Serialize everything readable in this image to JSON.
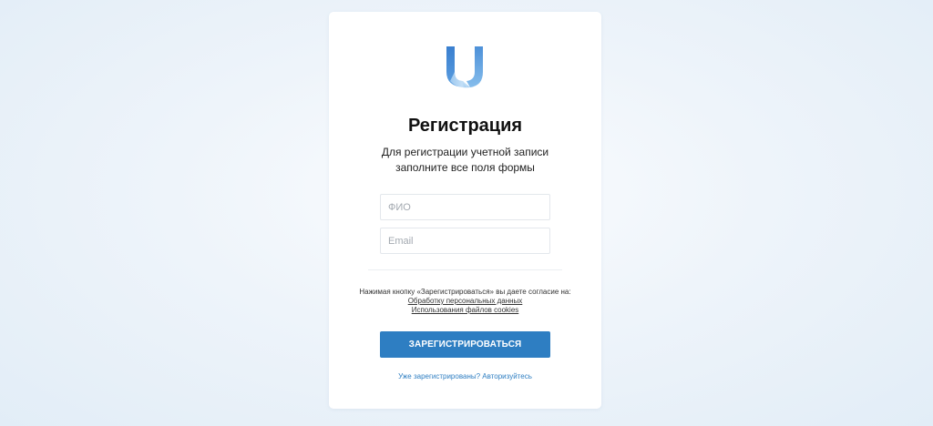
{
  "page": {
    "logo_icon": "brand-u-logo-icon",
    "title": "Регистрация",
    "subtitle_line1": "Для регистрации учетной записи",
    "subtitle_line2": "заполните все поля формы"
  },
  "form": {
    "fio_placeholder": "ФИО",
    "email_placeholder": "Email",
    "fio_value": "",
    "email_value": ""
  },
  "consent": {
    "text": "Нажимая кнопку «Зарегистрироваться» вы даете согласие на:",
    "link_personal_data": "Обработку персональных данных",
    "link_cookies": "Использования файлов cookies"
  },
  "actions": {
    "submit_label": "ЗАРЕГИСТРИРОВАТЬСЯ",
    "login_link": "Уже зарегистрированы? Авторизуйтесь"
  },
  "colors": {
    "accent": "#2e7ec2",
    "background": "#e9f1f8",
    "card": "#ffffff"
  }
}
